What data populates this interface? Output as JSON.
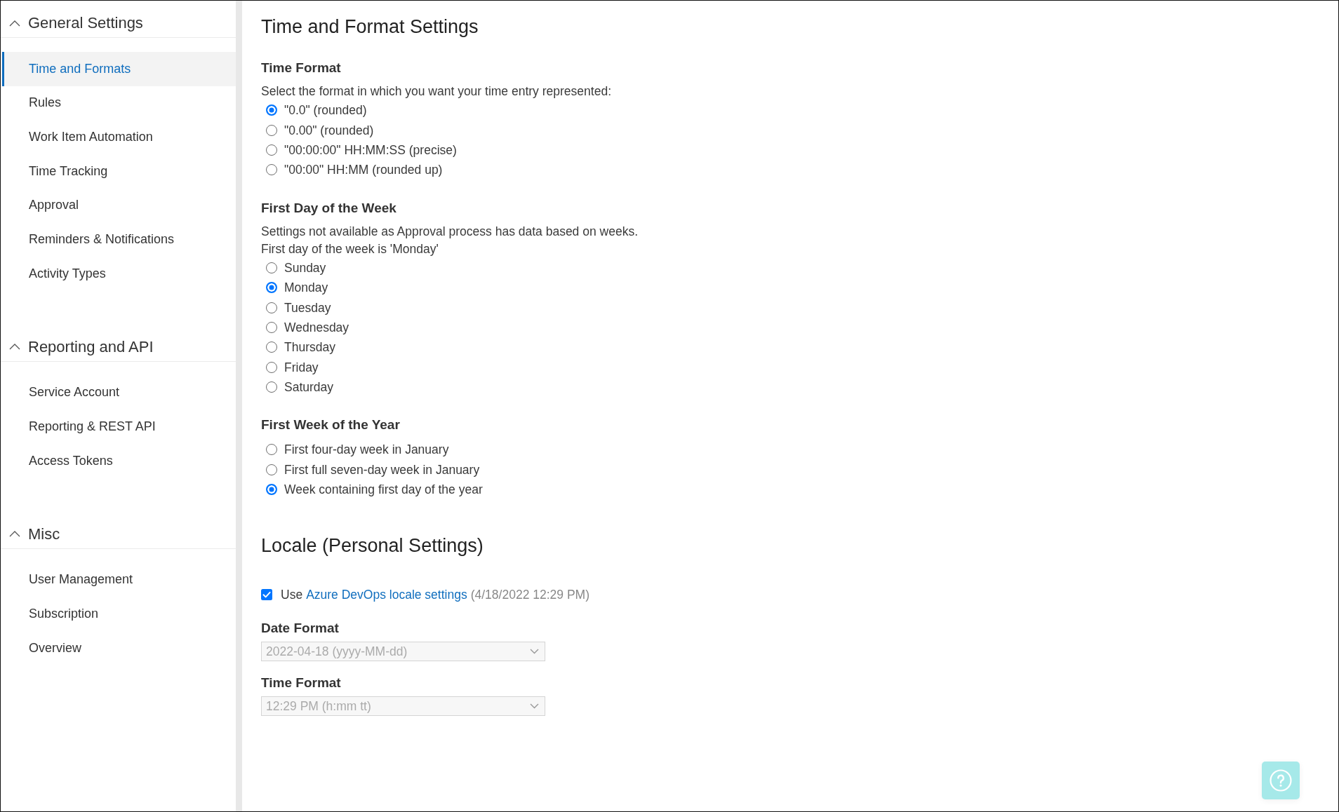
{
  "sidebar": {
    "sections": [
      {
        "title": "General Settings",
        "expanded": true,
        "items": [
          {
            "label": "Time and Formats",
            "selected": true
          },
          {
            "label": "Rules",
            "selected": false
          },
          {
            "label": "Work Item Automation",
            "selected": false
          },
          {
            "label": "Time Tracking",
            "selected": false
          },
          {
            "label": "Approval",
            "selected": false
          },
          {
            "label": "Reminders & Notifications",
            "selected": false
          },
          {
            "label": "Activity Types",
            "selected": false
          }
        ]
      },
      {
        "title": "Reporting and API",
        "expanded": true,
        "items": [
          {
            "label": "Service Account",
            "selected": false
          },
          {
            "label": "Reporting & REST API",
            "selected": false
          },
          {
            "label": "Access Tokens",
            "selected": false
          }
        ]
      },
      {
        "title": "Misc",
        "expanded": true,
        "items": [
          {
            "label": "User Management",
            "selected": false
          },
          {
            "label": "Subscription",
            "selected": false
          },
          {
            "label": "Overview",
            "selected": false
          }
        ]
      }
    ]
  },
  "page_title": "Time and Format Settings",
  "settings_groups": [
    {
      "title": "Time Format",
      "notes": [
        "Select the format in which you want your time entry represented:"
      ],
      "options": [
        {
          "label": "\"0.0\" (rounded)",
          "selected": true
        },
        {
          "label": "\"0.00\" (rounded)",
          "selected": false
        },
        {
          "label": "\"00:00:00\" HH:MM:SS (precise)",
          "selected": false
        },
        {
          "label": "\"00:00\" HH:MM (rounded up)",
          "selected": false
        }
      ]
    },
    {
      "title": "First Day of the Week",
      "notes": [
        "Settings not available as Approval process has data based on weeks.",
        "First day of the week is 'Monday'"
      ],
      "options": [
        {
          "label": "Sunday",
          "selected": false
        },
        {
          "label": "Monday",
          "selected": true
        },
        {
          "label": "Tuesday",
          "selected": false
        },
        {
          "label": "Wednesday",
          "selected": false
        },
        {
          "label": "Thursday",
          "selected": false
        },
        {
          "label": "Friday",
          "selected": false
        },
        {
          "label": "Saturday",
          "selected": false
        }
      ]
    },
    {
      "title": "First Week of the Year",
      "options": [
        {
          "label": "First four-day week in January",
          "selected": false
        },
        {
          "label": "First full seven-day week in January",
          "selected": false
        },
        {
          "label": "Week containing first day of the year",
          "selected": true
        }
      ]
    }
  ],
  "locale": {
    "title": "Locale (Personal Settings)",
    "use_devops_locale": {
      "checked": true,
      "label": "Use",
      "link": "Azure DevOps locale settings",
      "timestamp": "(4/18/2022 12:29 PM)"
    },
    "fields": [
      {
        "label": "Date Format",
        "value": "2022-04-18 (yyyy-MM-dd)",
        "disabled": true
      },
      {
        "label": "Time Format",
        "value": "12:29 PM (h:mm tt)",
        "disabled": true
      }
    ]
  }
}
